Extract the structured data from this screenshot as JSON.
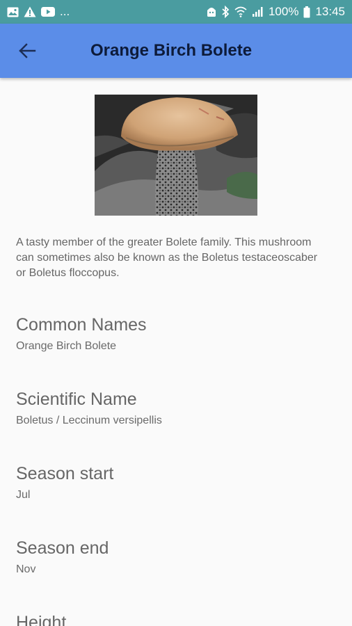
{
  "status_bar": {
    "left_icons": [
      "image-icon",
      "warning-icon",
      "youtube-icon"
    ],
    "overflow": "...",
    "right_icons": [
      "android-icon",
      "bluetooth-icon",
      "wifi-icon",
      "signal-icon"
    ],
    "battery": "100%",
    "time": "13:45"
  },
  "header": {
    "title": "Orange Birch Bolete",
    "back_icon": "arrow-back-icon"
  },
  "mushroom": {
    "description": "A tasty member of the greater Bolete family. This mushroom can sometimes also be known as the Boletus testaceoscaber or Boletus floccopus.",
    "fields": [
      {
        "label": "Common Names",
        "value": "Orange Birch Bolete"
      },
      {
        "label": "Scientific Name",
        "value": "Boletus / Leccinum versipellis"
      },
      {
        "label": "Season start",
        "value": "Jul"
      },
      {
        "label": "Season end",
        "value": "Nov"
      },
      {
        "label": "Height",
        "value": ""
      }
    ]
  },
  "colors": {
    "status_bar": "#4a9ca0",
    "app_bar": "#5b8de8",
    "title_text": "#0d1b3a",
    "background": "#fafafa",
    "body_text": "#666666"
  }
}
